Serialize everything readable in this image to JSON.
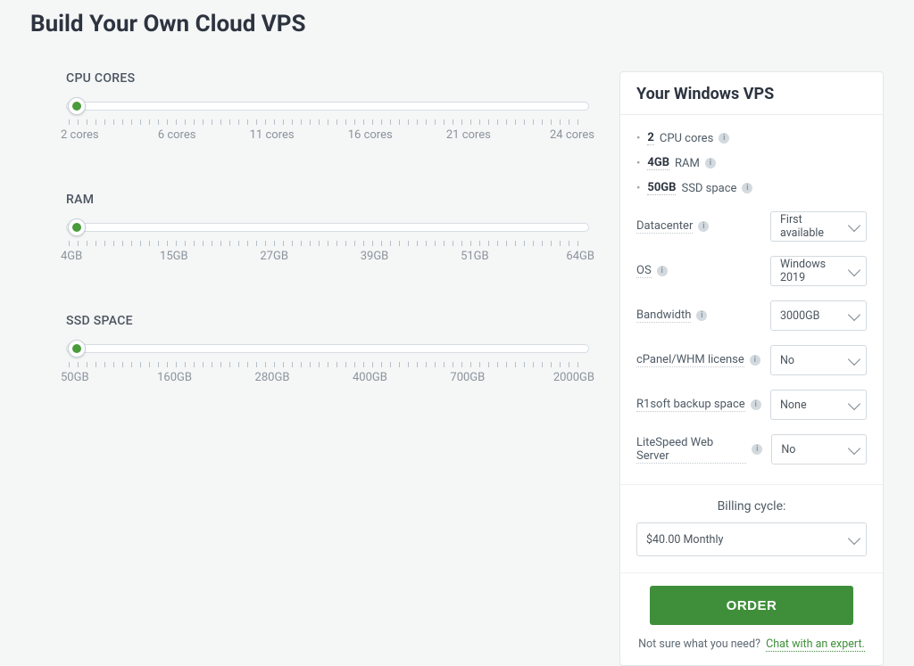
{
  "title": "Build Your Own Cloud VPS",
  "sliders": {
    "cpu": {
      "label": "CPU CORES",
      "ticks": [
        "2 cores",
        "6 cores",
        "11 cores",
        "16 cores",
        "21 cores",
        "24 cores"
      ],
      "value": "2 cores"
    },
    "ram": {
      "label": "RAM",
      "ticks": [
        "4GB",
        "15GB",
        "27GB",
        "39GB",
        "51GB",
        "64GB"
      ],
      "value": "4GB"
    },
    "ssd": {
      "label": "SSD SPACE",
      "ticks": [
        "50GB",
        "160GB",
        "280GB",
        "400GB",
        "700GB",
        "2000GB"
      ],
      "value": "50GB"
    }
  },
  "panel": {
    "heading": "Your Windows VPS",
    "specs": {
      "cpu_val": "2",
      "cpu_rest": "CPU cores",
      "ram_val": "4GB",
      "ram_rest": "RAM",
      "ssd_val": "50GB",
      "ssd_rest": "SSD space"
    },
    "options": {
      "datacenter": {
        "label": "Datacenter",
        "value": "First available"
      },
      "os": {
        "label": "OS",
        "value": "Windows 2019"
      },
      "bandwidth": {
        "label": "Bandwidth",
        "value": "3000GB"
      },
      "cpanel": {
        "label": "cPanel/WHM license",
        "value": "No"
      },
      "r1soft": {
        "label": "R1soft backup space",
        "value": "None"
      },
      "litespeed": {
        "label": "LiteSpeed Web Server",
        "value": "No"
      }
    },
    "billing": {
      "title": "Billing cycle:",
      "value": "$40.00 Monthly"
    },
    "order_label": "ORDER",
    "help_text": "Not sure what you need?",
    "help_link": "Chat with an expert."
  }
}
